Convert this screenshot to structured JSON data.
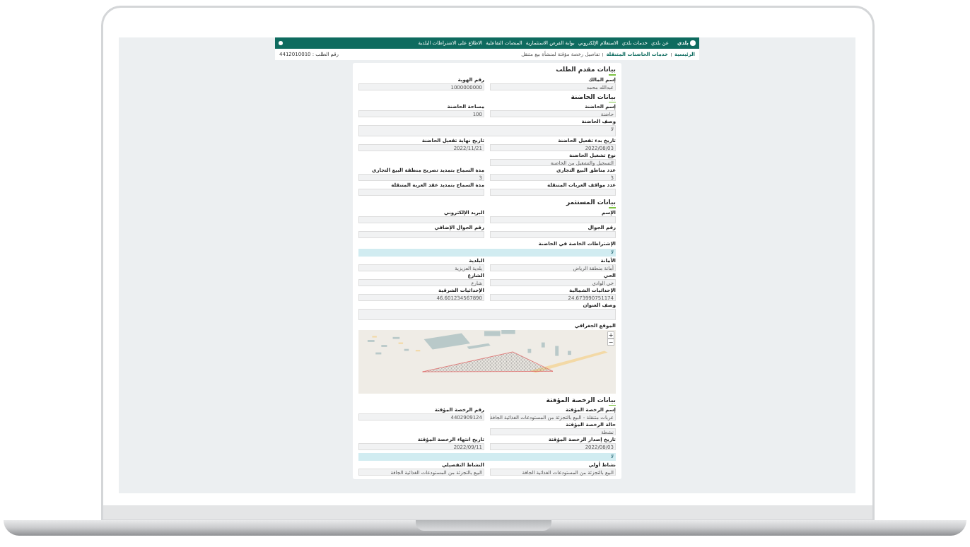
{
  "header": {
    "logo": "بلدي",
    "nav": [
      "عن بلدي",
      "خدمات بلدي",
      "الاستعلام الإلكتروني",
      "بوابة الفرص الاستثمارية",
      "المنصات التفاعلية",
      "الاطلاع على الاشتراطات البلدية"
    ]
  },
  "breadcrumb": {
    "items": [
      "الرئيسية",
      "خدمات الحاضنات المتنقلة",
      "تفاصيل رخصة مؤقتة لمنشأة بيع متنقل"
    ],
    "request_number": "رقم الطلب : 4412010010"
  },
  "sections": [
    {
      "title": "بيانات مقدم الطلب",
      "rows": [
        {
          "kind": "pair",
          "fields": [
            {
              "label": "إسم المالك",
              "value": "عبدالله محمد"
            },
            {
              "label": "رقم الهوية",
              "value": "1000000000"
            }
          ]
        }
      ]
    },
    {
      "title": "بيانات الحاضنة",
      "rows": [
        {
          "kind": "pair",
          "fields": [
            {
              "label": "إسم الحاضنة",
              "value": "حاضنة"
            },
            {
              "label": "مساحة الحاضنة",
              "value": "100"
            }
          ]
        },
        {
          "kind": "textarea",
          "label": "وصف الحاضنة",
          "value": "لا"
        },
        {
          "kind": "pair",
          "fields": [
            {
              "label": "تاريخ بدء تفعيل الحاضنة",
              "value": "2022/08/03"
            },
            {
              "label": "تاريخ نهاية تفعيل الحاضنة",
              "value": "2022/11/21"
            }
          ]
        },
        {
          "kind": "pair",
          "fields": [
            {
              "label": "نوع تشغيل الحاضنة",
              "value": "التسجيل والتشغيل من الحاضنة"
            }
          ]
        },
        {
          "kind": "pair",
          "fields": [
            {
              "label": "عدد مناطق البيع التجاري",
              "value": "3"
            },
            {
              "label": "مدة السماح بتمديد تصريح منطقة البيع التجاري",
              "value": "3"
            }
          ]
        },
        {
          "kind": "pair",
          "fields": [
            {
              "label": "عدد مواقف العربات المتنقلة"
            },
            {
              "label": "مدة السماح بتمديد عقد العربة المتنقلة"
            }
          ]
        }
      ]
    },
    {
      "title": "بيانات المستثمر",
      "rows": [
        {
          "kind": "pair",
          "fields": [
            {
              "label": "الإسم"
            },
            {
              "label": "البريد الإلكتروني"
            }
          ]
        },
        {
          "kind": "pair",
          "fields": [
            {
              "label": "رقم الجوال"
            },
            {
              "label": "رقم الجوال الإضافي"
            }
          ]
        },
        {
          "kind": "banner",
          "label": "الإشتراطات الخاصة في الحاضنة",
          "text": "لا"
        },
        {
          "kind": "pair",
          "fields": [
            {
              "label": "الأمانة",
              "value": "أمانة منطقة الرياض"
            },
            {
              "label": "البلدية",
              "value": "بلدية العزيزية"
            }
          ]
        },
        {
          "kind": "pair",
          "fields": [
            {
              "label": "الحي",
              "value": "حي الوادي"
            },
            {
              "label": "الشارع",
              "value": "شارع"
            }
          ]
        },
        {
          "kind": "pair",
          "fields": [
            {
              "label": "الإحداثيات الشمالية",
              "value": "24.673990751174"
            },
            {
              "label": "الإحداثيات الشرقية",
              "value": "46.601234567890"
            }
          ]
        },
        {
          "kind": "textarea",
          "label": "وصف العنوان"
        },
        {
          "kind": "map",
          "label": "الموقع الجغرافي",
          "zoom_in": "+",
          "zoom_out": "−"
        }
      ]
    },
    {
      "title": "بيانات الرخصة المؤقتة",
      "rows": [
        {
          "kind": "pair",
          "fields": [
            {
              "label": "إسم الرخصة المؤقتة",
              "value": "عربات متنقلة - البيع بالتجزئة من المستودعات الغذائية الجافة"
            },
            {
              "label": "رقم الرخصة المؤقتة",
              "value": "4402909124"
            }
          ]
        },
        {
          "kind": "pair",
          "fields": [
            {
              "label": "حالة الرخصة المؤقتة",
              "value": "نشطة"
            }
          ]
        },
        {
          "kind": "pair",
          "fields": [
            {
              "label": "تاريخ إصدار الرخصة المؤقتة",
              "value": "2022/08/03"
            },
            {
              "label": "تاريخ انتهاء الرخصة المؤقتة",
              "value": "2022/09/11"
            }
          ]
        },
        {
          "kind": "banner",
          "text": "لا"
        },
        {
          "kind": "pair",
          "fields": [
            {
              "label": "نشاط أولي",
              "value": "البيع بالتجزئة من المستودعات الغذائية الجافة"
            },
            {
              "label": "النشاط التفصيلي",
              "value": "البيع بالتجزئة من المستودعات الغذائية الجافة"
            }
          ]
        }
      ]
    }
  ]
}
